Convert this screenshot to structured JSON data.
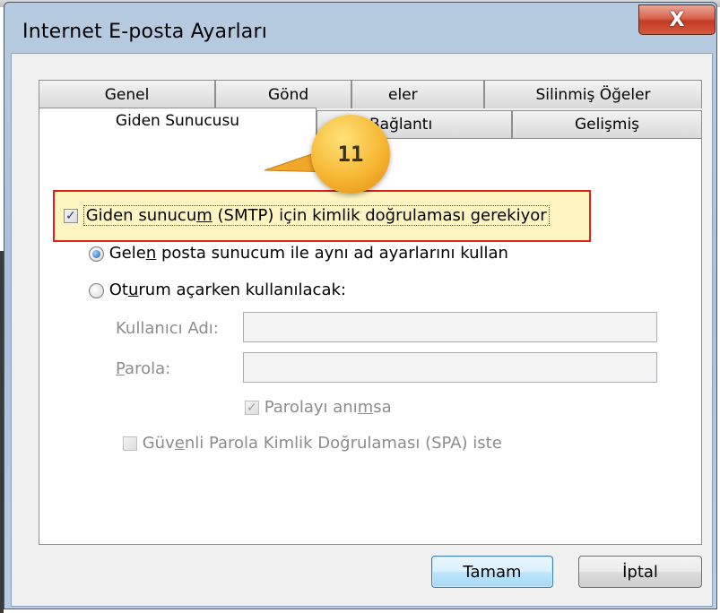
{
  "window": {
    "title": "Internet E-posta Ayarları",
    "close_label": "X"
  },
  "tabs_row1": [
    "Genel",
    "Gönd",
    "eler",
    "Silinmiş Öğeler"
  ],
  "tabs_row2": [
    "Giden Sunucusu",
    "Bağlantı",
    "Gelişmiş"
  ],
  "active_tab": "Giden Sunucusu",
  "callout": {
    "number": "11"
  },
  "smtp_auth": {
    "label_a": "Giden sunucu",
    "label_u": "m",
    "label_b": " (SMTP) için kimlik doğrulaması gerekiyor",
    "checked": true
  },
  "radio_same": {
    "label_a": "Gele",
    "label_u": "n",
    "label_b": " posta sunucum ile aynı ad ayarlarını kullan",
    "selected": true
  },
  "radio_logon": {
    "label_a": "Ot",
    "label_u": "u",
    "label_b": "rum açarken kullanılacak:",
    "selected": false
  },
  "username": {
    "label": "Kullanıcı Adı:",
    "value": ""
  },
  "password": {
    "label_u": "P",
    "label_b": "arola:",
    "value": ""
  },
  "remember_pw": {
    "label_a": "Parolayı anı",
    "label_u": "m",
    "label_b": "sa",
    "checked": true
  },
  "spa": {
    "label_a": "Güv",
    "label_u": "e",
    "label_b": "nli Parola Kimlik Doğrulaması (SPA) iste",
    "checked": false
  },
  "buttons": {
    "ok": "Tamam",
    "cancel": "İptal"
  },
  "colors": {
    "highlight_border": "#e0201b",
    "highlight_fill": "#fff5c0",
    "callout": "#f7b733"
  }
}
